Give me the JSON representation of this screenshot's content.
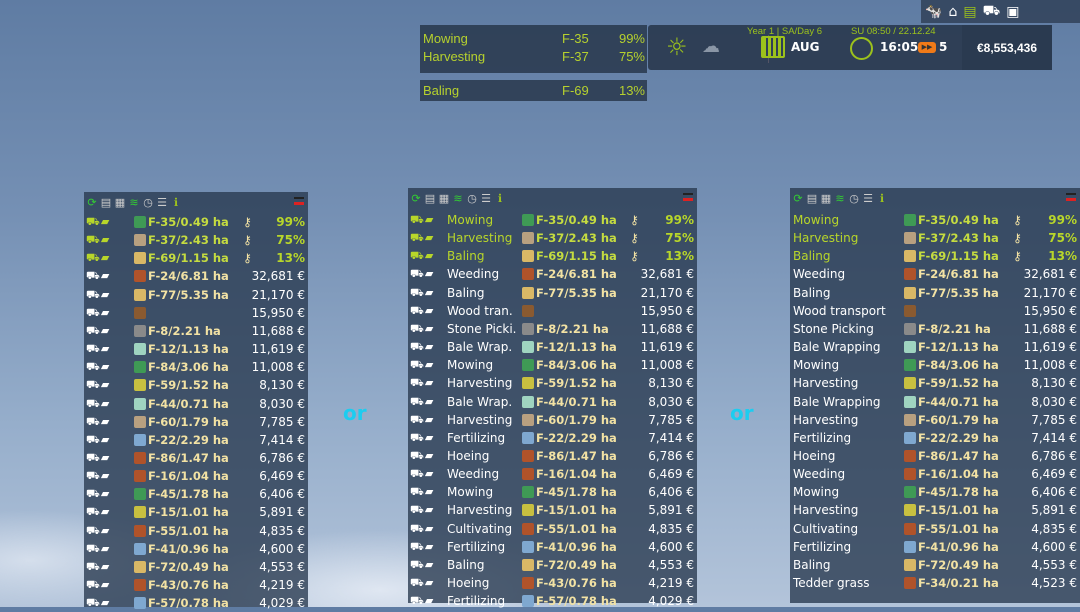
{
  "top_icons": [
    "cow-icon",
    "farm-buildings-icon",
    "finances-icon",
    "vehicles-icon",
    "contracts-icon"
  ],
  "active_jobs": [
    {
      "job": "Mowing",
      "field": "F-35",
      "progress": "99%"
    },
    {
      "job": "Harvesting",
      "field": "F-37",
      "progress": "75%"
    }
  ],
  "active_job2": {
    "job": "Baling",
    "field": "F-69",
    "progress": "13%"
  },
  "hud": {
    "weather_icons": [
      "sun-icon",
      "cloud-rain-icon"
    ],
    "year_day": "Year 1 | SA/Day 6",
    "month": "AUG",
    "date_time": "SU 08:50 / 22.12.24",
    "clock": "16:05",
    "speed": "5",
    "money": "€8,553,436"
  },
  "separator": "or",
  "colors": {
    "accent": "#9cc21c",
    "active": "#b8d62a",
    "field": "#f2e2a4",
    "or": "#1ccdf0"
  },
  "header_icons": [
    "refresh-icon",
    "list-icon",
    "list-detail-icon",
    "grass-icon",
    "clock-icon",
    "clear-filter-icon",
    "info-icon"
  ],
  "rows": [
    {
      "full": "Mowing",
      "short": "Mowing",
      "field": "F-35/0.49 ha",
      "value": "99%",
      "active": true,
      "ficon": "grass-icon",
      "fc": "#3f9a55"
    },
    {
      "full": "Harvesting",
      "short": "Harvesting",
      "field": "F-37/2.43 ha",
      "value": "75%",
      "active": true,
      "ficon": "crop-icon",
      "fc": "#b8a080"
    },
    {
      "full": "Baling",
      "short": "Baling",
      "field": "F-69/1.15 ha",
      "value": "13%",
      "active": true,
      "ficon": "bale-icon",
      "fc": "#d9b866"
    },
    {
      "full": "Weeding",
      "short": "Weeding",
      "field": "F-24/6.81 ha",
      "value": "32,681 €",
      "ficon": "soil-icon",
      "fc": "#b0532a"
    },
    {
      "full": "Baling",
      "short": "Baling",
      "field": "F-77/5.35 ha",
      "value": "21,170 €",
      "ficon": "bale-icon",
      "fc": "#d9b866"
    },
    {
      "full": "Wood transport",
      "short": "Wood tran.",
      "field": "",
      "value": "15,950 €",
      "ficon": "wood-icon",
      "fc": "#8a5a30"
    },
    {
      "full": "Stone Picking",
      "short": "Stone Picki.",
      "field": "F-8/2.21 ha",
      "value": "11,688 €",
      "ficon": "stones-icon",
      "fc": "#8a8a8a"
    },
    {
      "full": "Bale Wrapping",
      "short": "Bale Wrap.",
      "field": "F-12/1.13 ha",
      "value": "11,619 €",
      "ficon": "wrap-icon",
      "fc": "#9fd4c0"
    },
    {
      "full": "Mowing",
      "short": "Mowing",
      "field": "F-84/3.06 ha",
      "value": "11,008 €",
      "ficon": "grass-icon",
      "fc": "#3f9a55"
    },
    {
      "full": "Harvesting",
      "short": "Harvesting",
      "field": "F-59/1.52 ha",
      "value": "8,130 €",
      "ficon": "crop-icon",
      "fc": "#c8c040"
    },
    {
      "full": "Bale Wrapping",
      "short": "Bale Wrap.",
      "field": "F-44/0.71 ha",
      "value": "8,030 €",
      "ficon": "wrap-icon",
      "fc": "#9fd4c0"
    },
    {
      "full": "Harvesting",
      "short": "Harvesting",
      "field": "F-60/1.79 ha",
      "value": "7,785 €",
      "ficon": "crop-icon",
      "fc": "#b8a080"
    },
    {
      "full": "Fertilizing",
      "short": "Fertilizing",
      "field": "F-22/2.29 ha",
      "value": "7,414 €",
      "ficon": "fertilizer-icon",
      "fc": "#7fa8d0"
    },
    {
      "full": "Hoeing",
      "short": "Hoeing",
      "field": "F-86/1.47 ha",
      "value": "6,786 €",
      "ficon": "soil-icon",
      "fc": "#b0532a"
    },
    {
      "full": "Weeding",
      "short": "Weeding",
      "field": "F-16/1.04 ha",
      "value": "6,469 €",
      "ficon": "soil-icon",
      "fc": "#b0532a"
    },
    {
      "full": "Mowing",
      "short": "Mowing",
      "field": "F-45/1.78 ha",
      "value": "6,406 €",
      "ficon": "grass-icon",
      "fc": "#3f9a55"
    },
    {
      "full": "Harvesting",
      "short": "Harvesting",
      "field": "F-15/1.01 ha",
      "value": "5,891 €",
      "ficon": "crop-icon",
      "fc": "#c8c040"
    },
    {
      "full": "Cultivating",
      "short": "Cultivating",
      "field": "F-55/1.01 ha",
      "value": "4,835 €",
      "ficon": "soil-icon",
      "fc": "#b0532a"
    },
    {
      "full": "Fertilizing",
      "short": "Fertilizing",
      "field": "F-41/0.96 ha",
      "value": "4,600 €",
      "ficon": "fertilizer-icon",
      "fc": "#7fa8d0"
    },
    {
      "full": "Baling",
      "short": "Baling",
      "field": "F-72/0.49 ha",
      "value": "4,553 €",
      "ficon": "bale-icon",
      "fc": "#d9b866"
    },
    {
      "full": "Hoeing",
      "short": "Hoeing",
      "field": "F-43/0.76 ha",
      "value": "4,219 €",
      "ficon": "soil-icon",
      "fc": "#b0532a"
    },
    {
      "full": "Fertilizing",
      "short": "Fertilizing",
      "field": "F-57/0.78 ha",
      "value": "4,029 €",
      "ficon": "fertilizer-icon",
      "fc": "#7fa8d0"
    }
  ],
  "rows_right_extra": {
    "insert_before": 20,
    "row": {
      "full": "Tedder grass",
      "field": "F-34/0.21 ha",
      "value": "4,523 €",
      "ficon": "soil-icon",
      "fc": "#b0532a"
    }
  }
}
